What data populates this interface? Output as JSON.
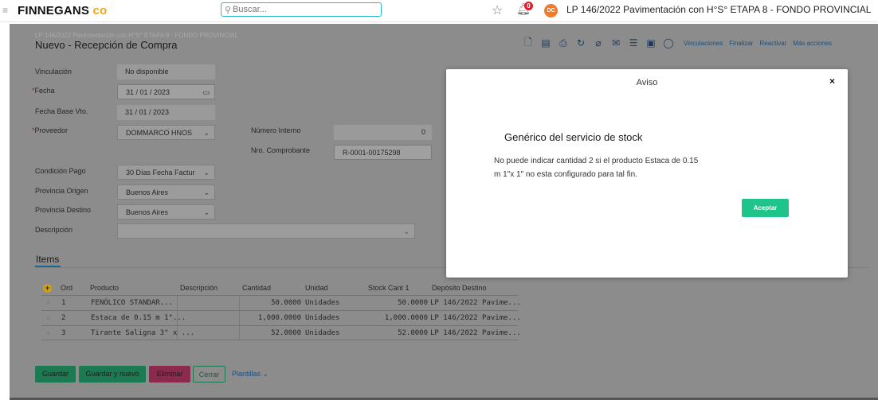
{
  "topbar": {
    "brand": "FINNEGANS",
    "brand_mark": "co",
    "search_placeholder": "Buscar...",
    "notifications_count": "0",
    "avatar_initials": "DC",
    "project_title": "LP 146/2022 Pavimentación con H°S° ETAPA 8 - FONDO PROVINCIAL"
  },
  "form": {
    "subtitle": "LP 146/2022 Pavimentación con H°S° ETAPA 8 - FONDO PROVINCIAL",
    "title": "Nuevo - Recepción de Compra",
    "toolbar": {
      "icons": [
        "new-document-icon",
        "save-icon",
        "print-icon",
        "history-icon",
        "attach-icon",
        "mail-icon",
        "list-icon",
        "report-icon",
        "comment-icon"
      ],
      "links": [
        "Vinculaciones",
        "Finalizar",
        "Reactivar",
        "Más acciones"
      ]
    },
    "labels": {
      "vinculacion": "Vinculación",
      "fecha": "Fecha",
      "fecha_base_vto": "Fecha Base Vto.",
      "proveedor": "Proveedor",
      "numero_interno": "Número Interno",
      "nro_comprobante": "Nro. Comprobante",
      "condicion_pago": "Condición Pago",
      "provincia_origen": "Provincia Origen",
      "provincia_destino": "Provincia Destino",
      "descripcion": "Descripción"
    },
    "values": {
      "vinculacion": "No disponible",
      "fecha": "31  /  01  /  2023",
      "fecha_base_vto": "31  /  01  /  2023",
      "proveedor": "DOMMARCO HNOS",
      "numero_interno": "0",
      "nro_comprobante": "R-0001-00175298",
      "condicion_pago": "30 Días Fecha Factur",
      "provincia_origen": "Buenos Aires",
      "provincia_destino": "Buenos Aires",
      "descripcion": ""
    }
  },
  "items": {
    "tab_label": "Items",
    "columns": [
      "Ord",
      "Producto",
      "Descripción",
      "Cantidad",
      "Unidad",
      "Stock Cant 1",
      "Depósito Destino"
    ],
    "rows": [
      {
        "ord": "1",
        "producto": "FENÓLICO STANDAR...",
        "descripcion": "",
        "cantidad": "50.0000",
        "unidad": "Unidades",
        "stock": "50.0000",
        "deposito": "LP 146/2022 Pavime..."
      },
      {
        "ord": "2",
        "producto": "Estaca de 0.15 m 1\"...",
        "descripcion": "",
        "cantidad": "1,000.0000",
        "unidad": "Unidades",
        "stock": "1,000.0000",
        "deposito": "LP 146/2022 Pavime..."
      },
      {
        "ord": "3",
        "producto": "Tirante Saligna 3\" x ...",
        "descripcion": "",
        "cantidad": "52.0000",
        "unidad": "Unidades",
        "stock": "52.0000",
        "deposito": "LP 146/2022 Pavime..."
      }
    ]
  },
  "actions": {
    "save": "Guardar",
    "save_new": "Guardar y nuevo",
    "delete": "Eliminar",
    "close": "Cerrar",
    "templates": "Plantillas"
  },
  "modal": {
    "title": "Aviso",
    "close": "×",
    "heading": "Genérico del servicio de stock",
    "message": "No puede indicar cantidad 2 si el producto Estaca de 0.15 m 1\"x 1\" no esta configurado para tal fin.",
    "accept": "Aceptar"
  },
  "colors": {
    "accent": "#1ec48a",
    "brand_mark": "#f2a40f",
    "search_border": "#2bb6d6",
    "overlay": "#8c8c8c"
  }
}
